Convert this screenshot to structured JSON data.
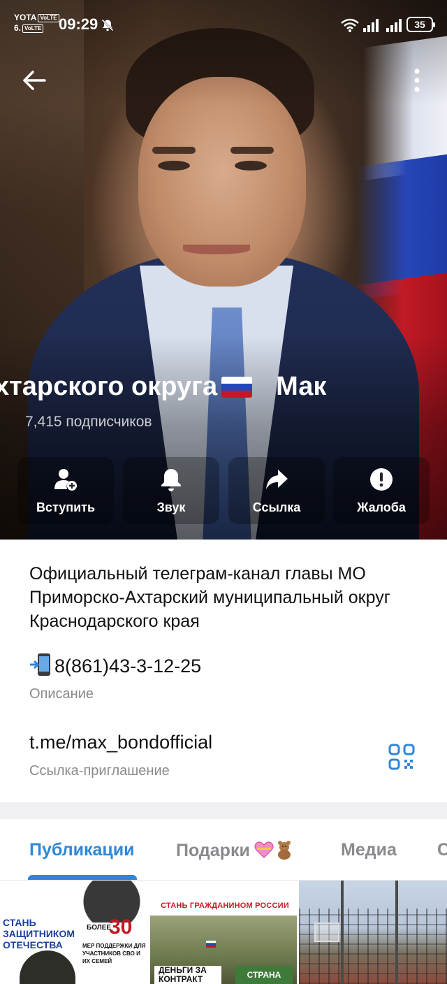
{
  "status_bar": {
    "carrier_line1": "YOTA",
    "carrier_line2": "6.",
    "volte": "VoLTE",
    "time": "09:29",
    "battery": "35"
  },
  "channel": {
    "title_part1": "хтарского округа",
    "title_part2": "Мак",
    "subscribers": "7,415 подписчиков"
  },
  "actions": [
    {
      "label": "Вступить",
      "icon": "add-user-icon"
    },
    {
      "label": "Звук",
      "icon": "bell-icon"
    },
    {
      "label": "Ссылка",
      "icon": "share-icon"
    },
    {
      "label": "Жалоба",
      "icon": "report-icon"
    }
  ],
  "info": {
    "description": "Официальный телеграм-канал главы МО Приморско-Ахтарский муниципальный округ Краснодарского края",
    "phone": "8(861)43-3-12-25",
    "description_label": "Описание",
    "link": "t.me/max_bondofficial",
    "link_label": "Ссылка-приглашение"
  },
  "tabs": [
    {
      "label": "Публикации",
      "active": true
    },
    {
      "label": "Подарки",
      "active": false
    },
    {
      "label": "Медиа",
      "active": false
    },
    {
      "label": "С",
      "active": false
    }
  ],
  "media": [
    {
      "title": "СТАНЬ ЗАЩИТНИКОМ ОТЕЧЕСТВА",
      "more": "БОЛЕЕ",
      "number": "30",
      "subtitle": "МЕР ПОДДЕРЖКИ ДЛЯ УЧАСТНИКОВ СВО И ИХ СЕМЕЙ"
    },
    {
      "title": "СТАНЬ ГРАЖДАНИНОМ РОССИИ",
      "left_text": "ДЕНЬГИ ЗА КОНТРАКТ",
      "right_text": "СТРАНА"
    },
    {
      "description": ""
    }
  ],
  "colors": {
    "accent": "#2f86d8",
    "text": "#111111",
    "secondary_text": "#8a8a8e",
    "background": "#f0f0f2"
  }
}
